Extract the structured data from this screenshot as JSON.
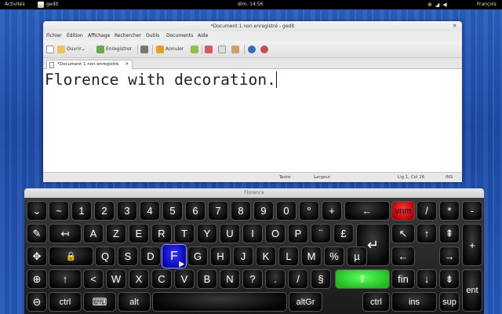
{
  "topbar": {
    "activities": "Activités",
    "app_name": "gedit",
    "clock": "dim. 14:56",
    "user": "François"
  },
  "gedit": {
    "title": "*Document 1 non enregistré - gedit",
    "menu": [
      "Fichier",
      "Édition",
      "Affichage",
      "Rechercher",
      "Outils",
      "Documents",
      "Aide"
    ],
    "toolbar": {
      "open": "Ouvrir",
      "save": "Enregistrer",
      "undo": "Annuler"
    },
    "tab": "*Document 1 non enregistré",
    "text": "Florence with decoration.",
    "status": {
      "lang": "Texte brut",
      "tabs": "Largeur des tabulations: 8",
      "pos": "Lig 1, Col 26",
      "mode": "INS"
    }
  },
  "florence": {
    "title": "Florence",
    "rows": [
      [
        "⌄",
        "~",
        "1",
        "2",
        "3",
        "4",
        "5",
        "6",
        "7",
        "8",
        "9",
        "0",
        "°",
        "+",
        "←",
        "vnm",
        "/",
        "*",
        "-"
      ],
      [
        "✎",
        "↤",
        "A",
        "Z",
        "E",
        "R",
        "T",
        "Y",
        "U",
        "I",
        "O",
        "P",
        "¨",
        "£",
        "↵",
        "↖",
        "↑",
        "⇞"
      ],
      [
        "✥",
        "🔒",
        "Q",
        "S",
        "D",
        "F",
        "G",
        "H",
        "J",
        "K",
        "L",
        "M",
        "%",
        "µ",
        "←",
        "→"
      ],
      [
        "⊕",
        "↑",
        "<",
        "W",
        "X",
        "C",
        "V",
        "B",
        "N",
        "?",
        ".",
        "/",
        "§",
        "⇑",
        "fin",
        "↓",
        "⇟",
        "+"
      ],
      [
        "⊖",
        "ctrl",
        "⌨",
        "alt",
        "",
        "altGr",
        "ctrl",
        "ins",
        "sup",
        "ent"
      ]
    ]
  }
}
